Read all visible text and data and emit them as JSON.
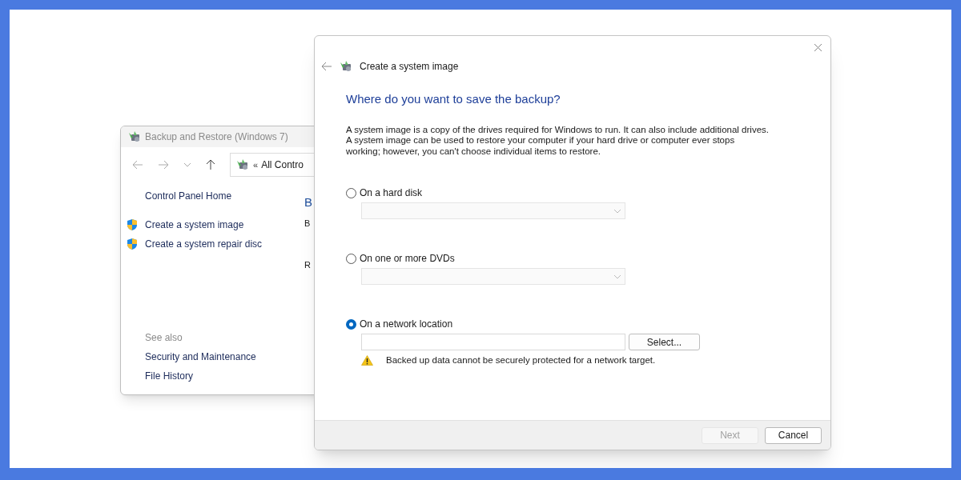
{
  "back_window": {
    "title": "Backup and Restore (Windows 7)",
    "address": {
      "chevron": "«",
      "text": "All Contro"
    },
    "sidebar": {
      "home": "Control Panel Home",
      "tasks": [
        {
          "label": "Create a system image"
        },
        {
          "label": "Create a system repair disc"
        }
      ],
      "see_also_title": "See also",
      "see_also": [
        "Security and Maintenance",
        "File History"
      ]
    },
    "content_fragments": [
      {
        "kind": "heading",
        "text": "B"
      },
      {
        "kind": "text",
        "text": "B"
      },
      {
        "kind": "text",
        "text": "R"
      }
    ]
  },
  "wizard": {
    "title": "Create a system image",
    "heading": "Where do you want to save the backup?",
    "description": "A system image is a copy of the drives required for Windows to run. It can also include additional drives. A system image can be used to restore your computer if your hard drive or computer ever stops working; however, you can't choose individual items to restore.",
    "options": [
      {
        "label": "On a hard disk",
        "selected": false,
        "kind": "dropdown",
        "disabled": true
      },
      {
        "label": "On one or more DVDs",
        "selected": false,
        "kind": "dropdown",
        "disabled": true
      },
      {
        "label": "On a network location",
        "selected": true,
        "kind": "path",
        "button": "Select..."
      }
    ],
    "warning": "Backed up data cannot be securely protected for a network target.",
    "buttons": [
      {
        "label": "Next",
        "disabled": true
      },
      {
        "label": "Cancel",
        "disabled": false
      }
    ]
  }
}
